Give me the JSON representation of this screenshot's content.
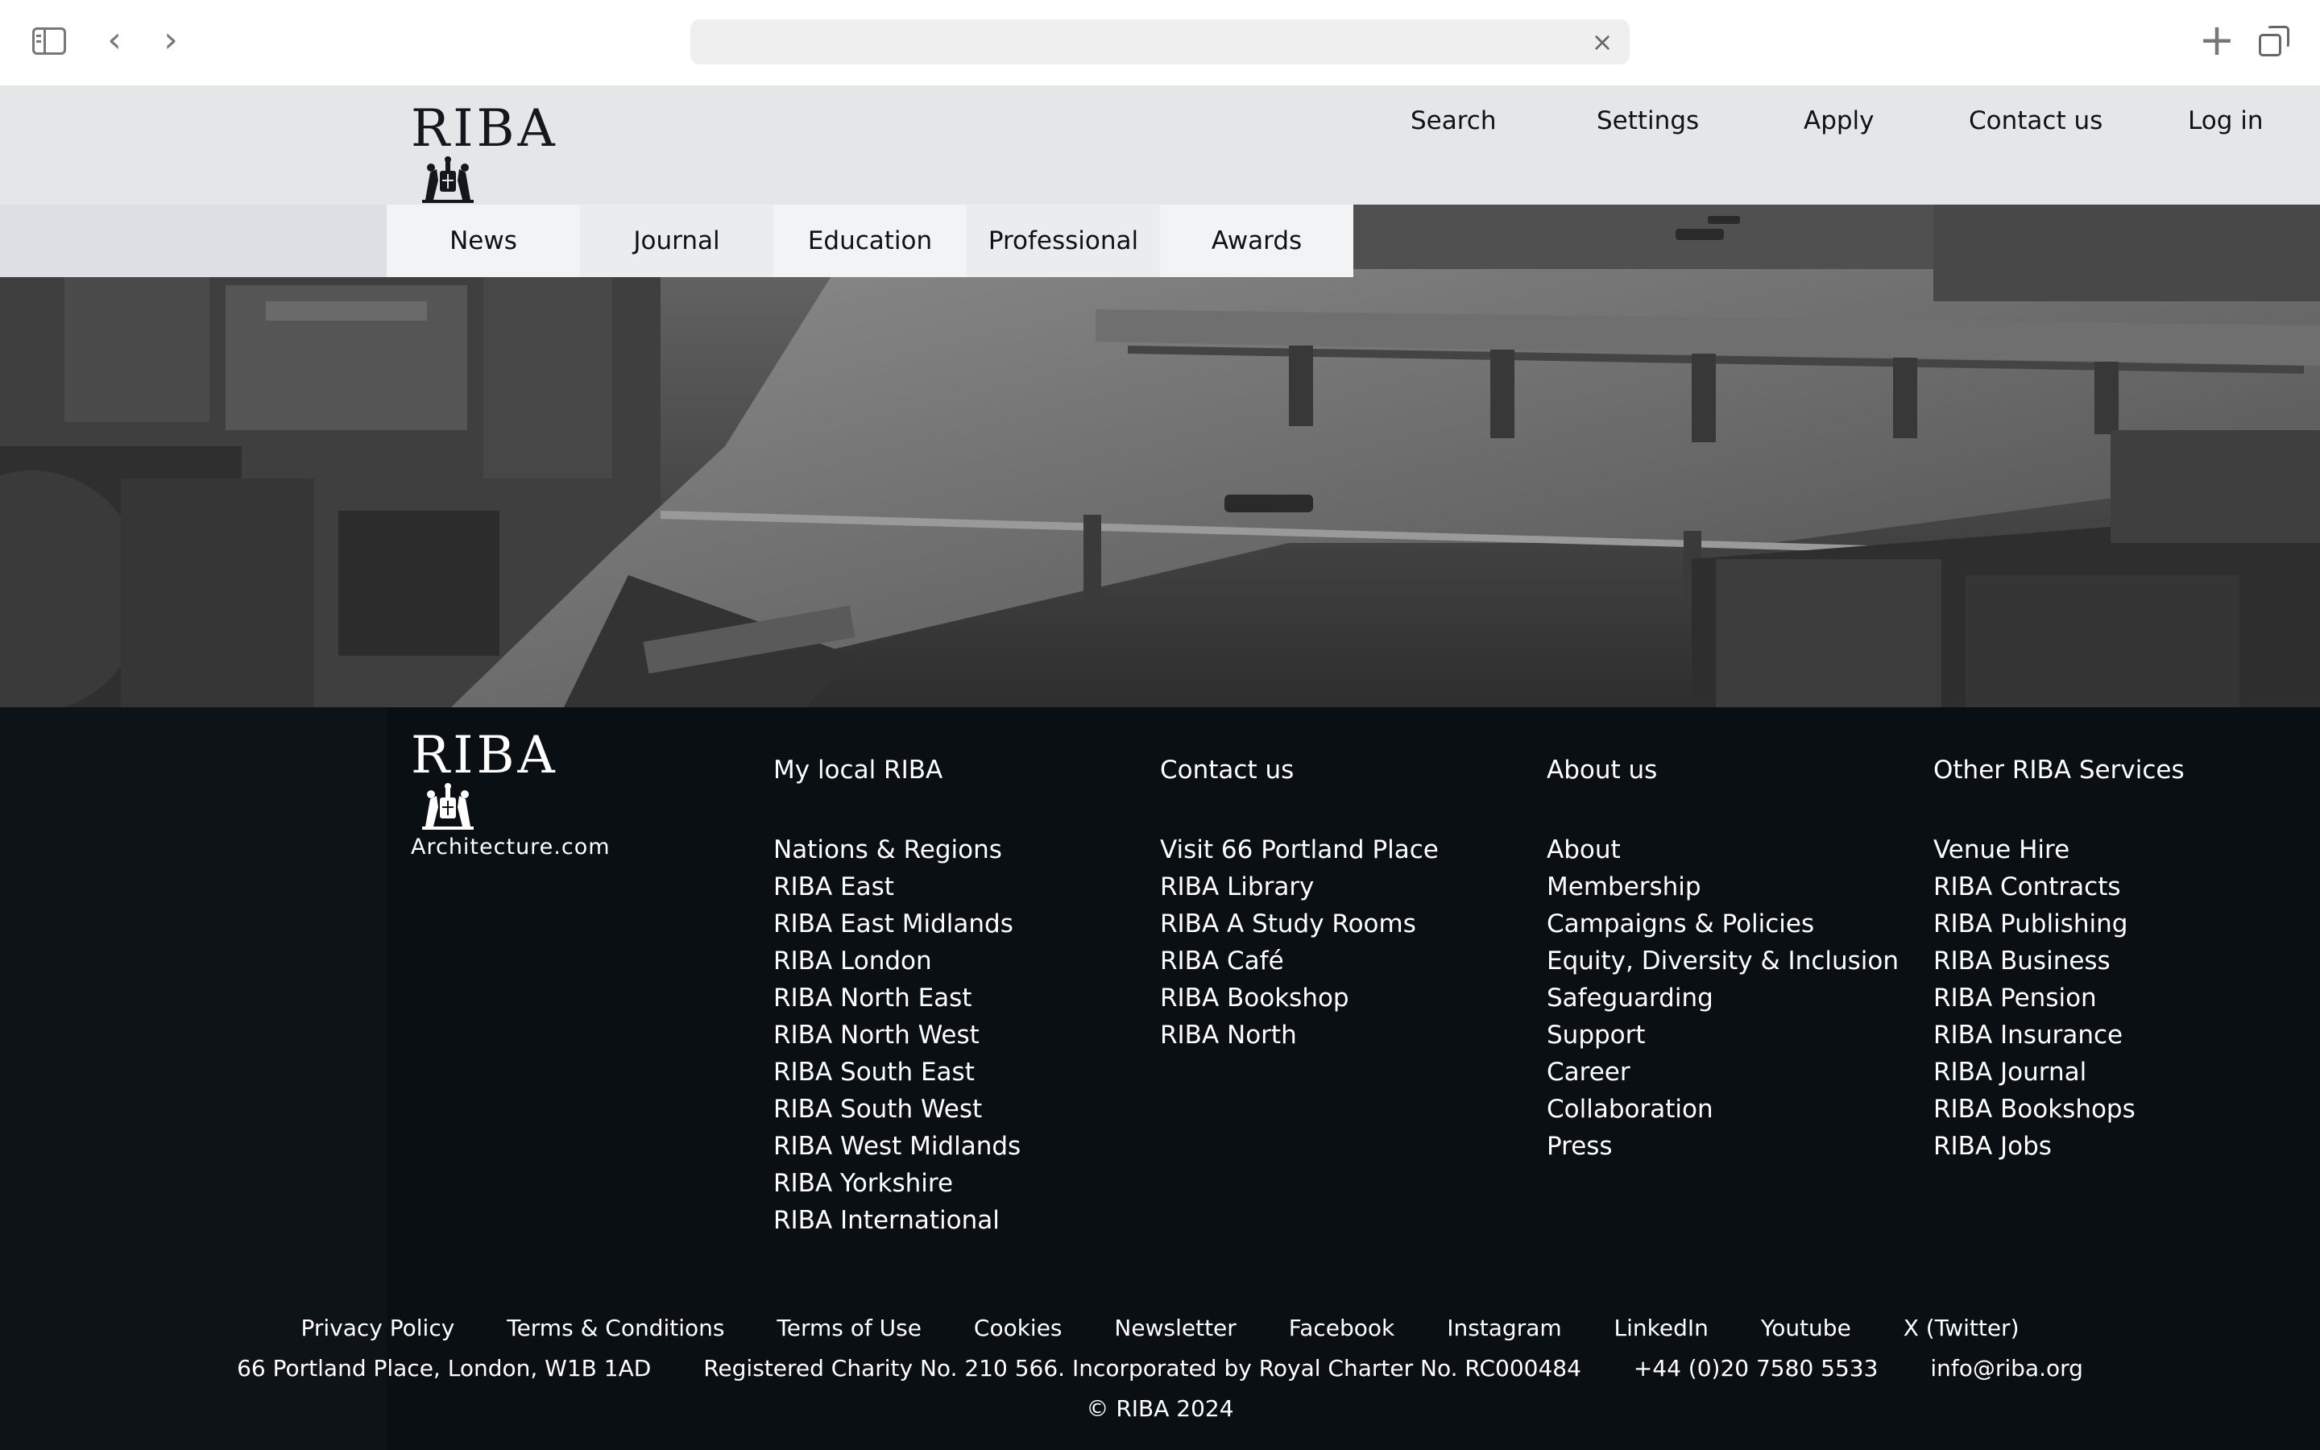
{
  "browser": {
    "address_placeholder": "",
    "back_glyph": "‹",
    "forward_glyph": "›",
    "clear_glyph": "×",
    "new_tab_glyph": "+"
  },
  "brand": {
    "wordmark": "RIBA",
    "subtitle": "Architecture.com"
  },
  "utility_nav": [
    {
      "label": "Search"
    },
    {
      "label": "Settings"
    },
    {
      "label": "Apply"
    },
    {
      "label": "Contact us"
    },
    {
      "label": "Log in"
    }
  ],
  "main_nav": [
    {
      "label": "News"
    },
    {
      "label": "Journal"
    },
    {
      "label": "Education"
    },
    {
      "label": "Professional"
    },
    {
      "label": "Awards"
    }
  ],
  "footer": {
    "columns": [
      {
        "heading": "My local RIBA",
        "links": [
          "Nations & Regions",
          "RIBA East",
          "RIBA East Midlands",
          "RIBA London",
          "RIBA North East",
          "RIBA North West",
          "RIBA South East",
          "RIBA South West",
          "RIBA West Midlands",
          "RIBA Yorkshire",
          "RIBA International"
        ]
      },
      {
        "heading": "Contact us",
        "links": [
          "Visit 66 Portland Place",
          "RIBA Library",
          "RIBA A Study Rooms",
          "RIBA Café",
          "RIBA Bookshop",
          "RIBA North"
        ]
      },
      {
        "heading": "About us",
        "links": [
          "About",
          "Membership",
          "Campaigns & Policies",
          "Equity, Diversity & Inclusion",
          "Safeguarding",
          "Support",
          "Career",
          "Collaboration",
          "Press"
        ]
      },
      {
        "heading": "Other RIBA Services",
        "links": [
          "Venue Hire",
          "RIBA Contracts",
          "RIBA Publishing",
          "RIBA Business",
          "RIBA Pension",
          "RIBA Insurance",
          "RIBA Journal",
          "RIBA Bookshops",
          "RIBA Jobs"
        ]
      }
    ],
    "legal_links": [
      "Privacy Policy",
      "Terms & Conditions",
      "Terms of Use",
      "Cookies",
      "Newsletter",
      "Facebook",
      "Instagram",
      "LinkedIn",
      "Youtube",
      "X (Twitter)"
    ],
    "address": "66 Portland Place, London, W1B 1AD",
    "charity": "Registered Charity No. 210 566. Incorporated by Royal Charter No. RC000484",
    "phone": "+44 (0)20 7580 5533",
    "email": "info@riba.org",
    "copyright": "© RIBA 2024"
  },
  "colors": {
    "header_bg": "#e5e6e8",
    "footer_bg": "#0a0f13",
    "tab_bg": "#f2f3f5"
  }
}
